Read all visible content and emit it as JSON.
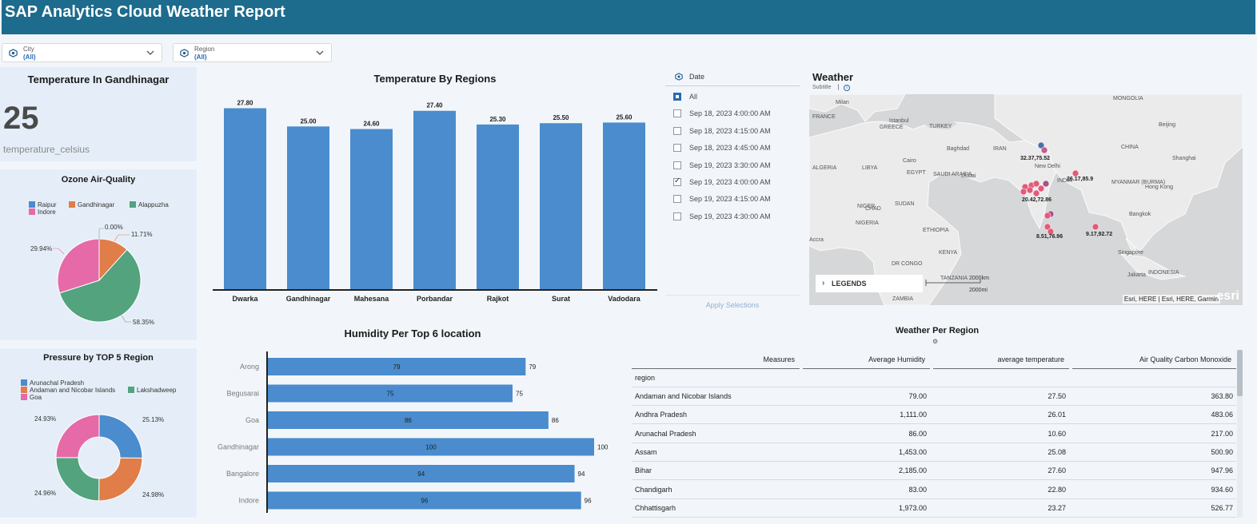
{
  "header": {
    "title": "SAP Analytics Cloud Weather Report"
  },
  "filters": [
    {
      "label": "City",
      "value": "(All)"
    },
    {
      "label": "Region",
      "value": "(All)"
    }
  ],
  "kpi": {
    "title": "Temperature In Gandhinagar",
    "value": "25",
    "label": "temperature_celsius"
  },
  "colors": {
    "blue": "#4a8ccd",
    "orange": "#e07d49",
    "green": "#52a37e",
    "pink": "#e66aa8"
  },
  "ozone": {
    "title": "Ozone Air-Quality",
    "legend": [
      "Raipur",
      "Gandhinagar",
      "Alappuzha",
      "Indore"
    ],
    "labels": [
      "0.00%",
      "11.71%",
      "58.35%",
      "29.94%"
    ]
  },
  "pressure": {
    "title": "Pressure by TOP 5 Region",
    "legend": [
      "Arunachal Pradesh",
      "Andaman and Nicobar Islands",
      "Lakshadweep",
      "Goa"
    ],
    "labels": [
      "25.13%",
      "24.98%",
      "24.96%",
      "24.93%"
    ]
  },
  "date_filter": {
    "title": "Date",
    "items": [
      {
        "label": "All",
        "state": "partial"
      },
      {
        "label": "Sep 18, 2023 4:00:00 AM",
        "state": "off"
      },
      {
        "label": "Sep 18, 2023 4:15:00 AM",
        "state": "off"
      },
      {
        "label": "Sep 18, 2023 4:45:00 AM",
        "state": "off"
      },
      {
        "label": "Sep 19, 2023 3:30:00 AM",
        "state": "off"
      },
      {
        "label": "Sep 19, 2023 4:00:00 AM",
        "state": "on"
      },
      {
        "label": "Sep 19, 2023 4:15:00 AM",
        "state": "off"
      },
      {
        "label": "Sep 19, 2023 4:30:00 AM",
        "state": "off"
      }
    ],
    "apply_label": "Apply Selections"
  },
  "map": {
    "title": "Weather",
    "subtitle": "Subtitle",
    "legends_label": "LEGENDS",
    "attribution": "Esri, HERE | Esri, HERE, Garmin",
    "logo": "esri",
    "scale_km": "2000km",
    "scale_mi": "2000mi",
    "places": [
      "Milan",
      "FRANCE",
      "Istanbul",
      "TURKEY",
      "GREECE",
      "Baghdad",
      "IRAN",
      "Cairo",
      "EGYPT",
      "SAUDI ARABIA",
      "Dubai",
      "ALGERIA",
      "LIBYA",
      "NIGER",
      "CHAD",
      "SUDAN",
      "NIGERIA",
      "ETHIOPIA",
      "Accra",
      "DR CONGO",
      "KENYA",
      "TANZANIA",
      "ZAMBIA",
      "MONGOLIA",
      "Beijing",
      "CHINA",
      "Shanghai",
      "Hong Kong",
      "MYANMAR (BURMA)",
      "Bangkok",
      "Singapore",
      "Jakarta",
      "INDONESIA",
      "INDIA",
      "New Delhi"
    ],
    "point_labels": [
      "32.37,75.52",
      "26.17,85.9",
      "20.42,72.86",
      "8.51,76.96",
      "9.17,92.72"
    ]
  },
  "chart_data": [
    {
      "type": "bar",
      "title": "Temperature By Regions",
      "categories": [
        "Dwarka",
        "Gandhinagar",
        "Mahesana",
        "Porbandar",
        "Rajkot",
        "Surat",
        "Vadodara"
      ],
      "values": [
        27.8,
        25.0,
        24.6,
        27.4,
        25.3,
        25.5,
        25.6
      ],
      "value_labels": [
        "27.80",
        "25.00",
        "24.60",
        "27.40",
        "25.30",
        "25.50",
        "25.60"
      ],
      "ylim": [
        0,
        30
      ]
    },
    {
      "type": "pie",
      "title": "Ozone Air-Quality",
      "categories": [
        "Raipur",
        "Gandhinagar",
        "Alappuzha",
        "Indore"
      ],
      "values": [
        0.0,
        11.71,
        58.35,
        29.94
      ]
    },
    {
      "type": "pie",
      "title": "Pressure by TOP 5 Region",
      "categories": [
        "Arunachal Pradesh",
        "Andaman and Nicobar Islands",
        "Lakshadweep",
        "Goa"
      ],
      "values": [
        25.13,
        24.98,
        24.96,
        24.93
      ]
    },
    {
      "type": "bar",
      "orientation": "horizontal",
      "title": "Humidity Per Top 6 location",
      "categories": [
        "Arong",
        "Begusarai",
        "Goa",
        "Gandhinagar",
        "Bangalore",
        "Indore"
      ],
      "values": [
        79,
        75,
        86,
        100,
        94,
        96
      ],
      "value_labels": [
        "79",
        "75",
        "86",
        "100",
        "94",
        "96"
      ],
      "xlim": [
        0,
        100
      ]
    },
    {
      "type": "table",
      "title": "Weather Per Region",
      "columns": [
        "Measures",
        "Average Humidity",
        "average temperature",
        "Air Quality Carbon Monoxide"
      ],
      "row_header": "region",
      "rows": [
        [
          "Andaman and Nicobar Islands",
          "79.00",
          "27.50",
          "363.80"
        ],
        [
          "Andhra Pradesh",
          "1,111.00",
          "26.01",
          "483.06"
        ],
        [
          "Arunachal Pradesh",
          "86.00",
          "10.60",
          "217.00"
        ],
        [
          "Assam",
          "1,453.00",
          "25.08",
          "500.90"
        ],
        [
          "Bihar",
          "2,185.00",
          "27.60",
          "947.96"
        ],
        [
          "Chandigarh",
          "83.00",
          "22.80",
          "934.60"
        ],
        [
          "Chhattisgarh",
          "1,973.00",
          "23.27",
          "526.77"
        ]
      ]
    }
  ]
}
